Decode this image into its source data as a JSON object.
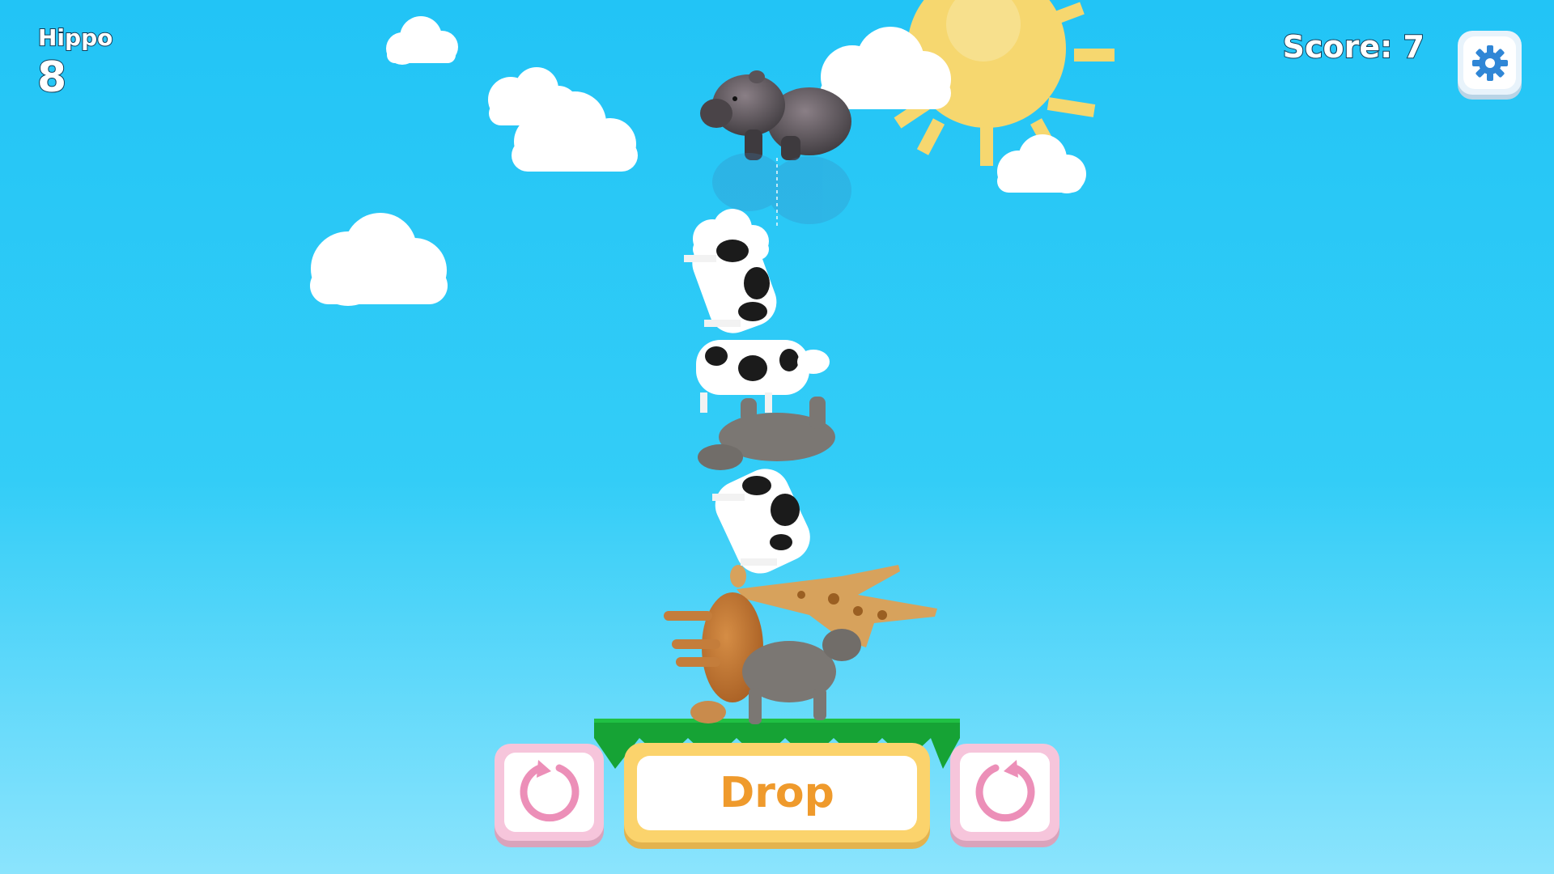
{
  "hud": {
    "animal_name": "Hippo",
    "animal_count": "8",
    "score_text": "Score: 7"
  },
  "controls": {
    "drop_label": "Drop",
    "rotate_left_icon": "rotate-icon",
    "rotate_right_icon": "rotate-icon",
    "settings_icon": "gear-icon"
  },
  "scene": {
    "falling_animal": "hippo",
    "stacked_animals": [
      "cow",
      "cow",
      "elephant",
      "cow",
      "giraffe",
      "lion",
      "elephant"
    ]
  },
  "colors": {
    "sky_top": "#22c4f6",
    "sky_bottom": "#8be4fd",
    "grass": "#16a335",
    "sun": "#f6d76f",
    "drop_button": "#fbd36c",
    "drop_text": "#ef9a2c",
    "rotate_button": "#f6c5db",
    "rotate_icon": "#ec8fb8",
    "settings_gear": "#2f86d6"
  }
}
